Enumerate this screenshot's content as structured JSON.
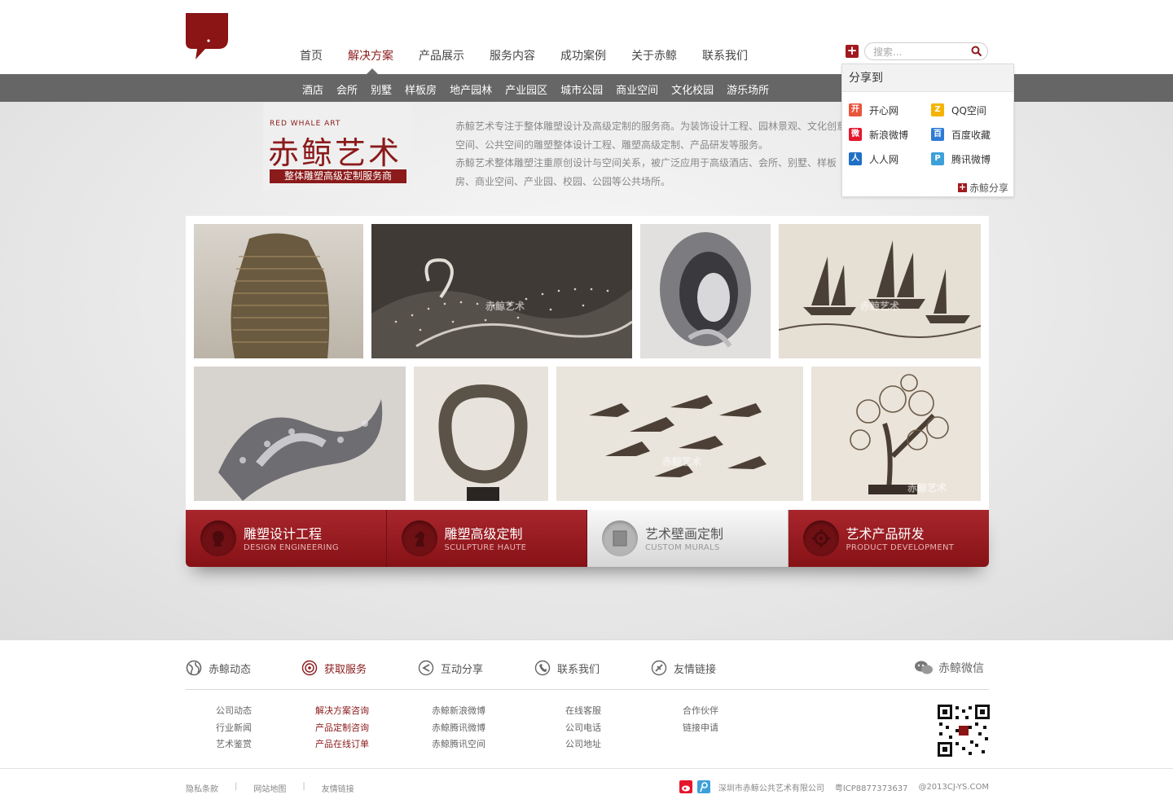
{
  "nav": {
    "items": [
      "首页",
      "解决方案",
      "产品展示",
      "服务内容",
      "成功案例",
      "关于赤鲸",
      "联系我们"
    ],
    "active": "解决方案"
  },
  "search": {
    "placeholder": "搜索..."
  },
  "subnav": {
    "items": [
      "酒店",
      "会所",
      "别墅",
      "样板房",
      "地产园林",
      "产业园区",
      "城市公园",
      "商业空间",
      "文化校园",
      "游乐场所"
    ]
  },
  "brand": {
    "en": "RED WHALE ART",
    "cn": "赤鲸艺术",
    "tagline": "整体雕塑高级定制服务商"
  },
  "intro": {
    "p1": "赤鲸艺术专注于整体雕塑设计及高级定制的服务商。为装饰设计工程、园林景观、文化创意空间、公共空间的雕塑整体设计工程、雕塑高级定制、产品研发等服务。",
    "p2": "赤鲸艺术整体雕塑注重原创设计与空间关系，被广泛应用于高级酒店、会所、别墅、样板房、商业空间、产业园、校园、公园等公共场所。"
  },
  "share": {
    "title": "分享到",
    "items": [
      {
        "label": "开心网",
        "icon": "kaixin-icon",
        "color": "#e8543c"
      },
      {
        "label": "QQ空间",
        "icon": "qzone-icon",
        "color": "#f4b400"
      },
      {
        "label": "新浪微博",
        "icon": "weibo-icon",
        "color": "#e6162d"
      },
      {
        "label": "百度收藏",
        "icon": "baidu-icon",
        "color": "#2e7bd6"
      },
      {
        "label": "人人网",
        "icon": "renren-icon",
        "color": "#1f6fc6"
      },
      {
        "label": "腾讯微博",
        "icon": "tencent-weibo-icon",
        "color": "#3da1d9"
      }
    ],
    "footer": "赤鲸分享"
  },
  "gallery": {
    "watermark": "赤鲸艺术"
  },
  "services": [
    {
      "title": "雕塑设计工程",
      "subtitle": "DESIGN ENGINEERING",
      "icon": "head-bust-icon"
    },
    {
      "title": "雕塑高级定制",
      "subtitle": "SCULPTURE HAUTE",
      "icon": "chess-knight-icon"
    },
    {
      "title": "艺术壁画定制",
      "subtitle": "CUSTOM MURALS",
      "icon": "mural-frame-icon"
    },
    {
      "title": "艺术产品研发",
      "subtitle": "PRODUCT DEVELOPMENT",
      "icon": "gear-icon"
    }
  ],
  "footer": {
    "columns": [
      {
        "title": "赤鲸动态",
        "icon": "globe-icon",
        "links": [
          "公司动态",
          "行业新闻",
          "艺术鉴赏"
        ]
      },
      {
        "title": "获取服务",
        "icon": "target-icon",
        "links": [
          "解决方案咨询",
          "产品定制咨询",
          "产品在线订单"
        ]
      },
      {
        "title": "互动分享",
        "icon": "share-arrow-icon",
        "links": [
          "赤鲸新浪微博",
          "赤鲸腾讯微博",
          "赤鲸腾讯空间"
        ]
      },
      {
        "title": "联系我们",
        "icon": "phone-icon",
        "links": [
          "在线客服",
          "公司电话",
          "公司地址"
        ]
      },
      {
        "title": "友情链接",
        "icon": "link-icon",
        "links": [
          "合作伙伴",
          "链接申请"
        ]
      }
    ],
    "wechat": "赤鲸微信",
    "bottom_links": [
      "隐私条款",
      "网站地图",
      "友情链接"
    ],
    "company": "深圳市赤鲸公共艺术有限公司",
    "icp": "粤ICP8877373637",
    "copyright": "@2013CJ-YS.COM"
  },
  "colors": {
    "brand_red": "#8b1a1a",
    "service_red": "#a8262c",
    "subnav_gray": "#666666"
  }
}
